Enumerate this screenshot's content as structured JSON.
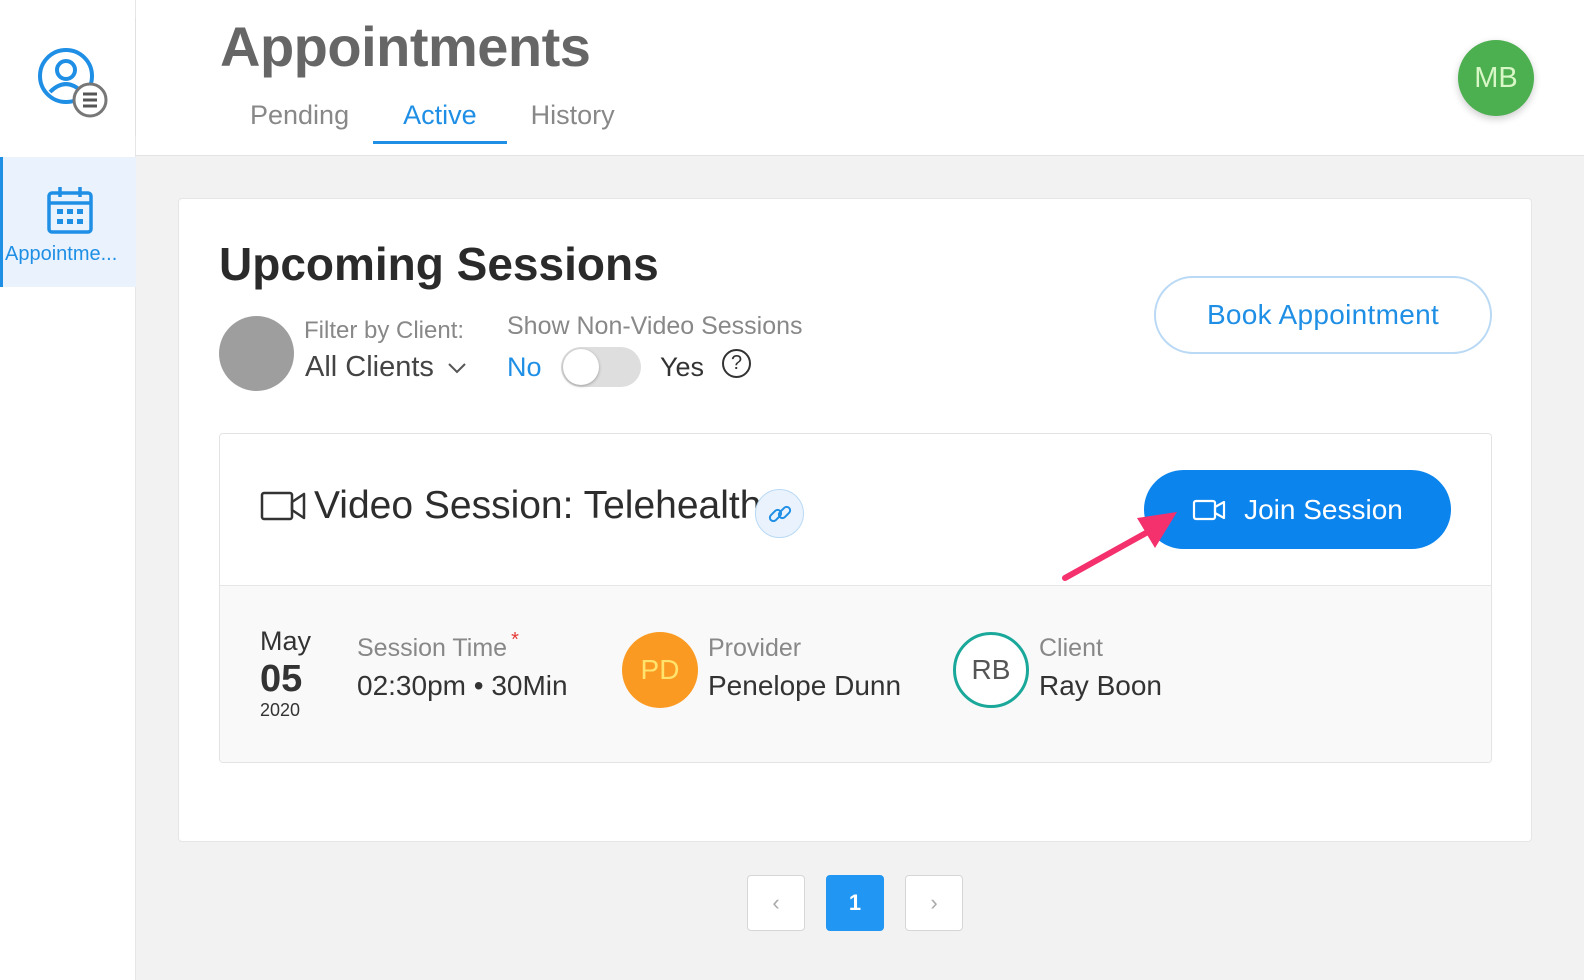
{
  "rail": {
    "items": [
      {
        "label": "Appointme...",
        "icon": "calendar-icon"
      }
    ]
  },
  "header": {
    "title": "Appointments",
    "tabs": [
      {
        "label": "Pending"
      },
      {
        "label": "Active"
      },
      {
        "label": "History"
      }
    ],
    "active_tab": "Active",
    "user_initials": "MB"
  },
  "main": {
    "title": "Upcoming Sessions",
    "filter": {
      "label": "Filter by Client:",
      "value": "All Clients"
    },
    "toggle": {
      "label": "Show Non-Video Sessions",
      "off_label": "No",
      "on_label": "Yes",
      "value": false,
      "help": "?"
    },
    "book_button": "Book Appointment",
    "session": {
      "title": "Video Session: Telehealth",
      "join_button": "Join Session",
      "date": {
        "month": "May",
        "day": "05",
        "year": "2020"
      },
      "time_label": "Session Time",
      "required_mark": "*",
      "time_value": "02:30pm • 30Min",
      "provider": {
        "label": "Provider",
        "name": "Penelope Dunn",
        "initials": "PD"
      },
      "client": {
        "label": "Client",
        "name": "Ray Boon",
        "initials": "RB"
      }
    }
  },
  "pagination": {
    "prev": "‹",
    "current": "1",
    "next": "›"
  },
  "colors": {
    "accent": "#1f8fe6",
    "join": "#0b84ee",
    "avatar_mb": "#4caf50",
    "avatar_pd": "#fb9a22",
    "avatar_rb_border": "#1aa89a",
    "annotation_arrow": "#f4306d"
  }
}
